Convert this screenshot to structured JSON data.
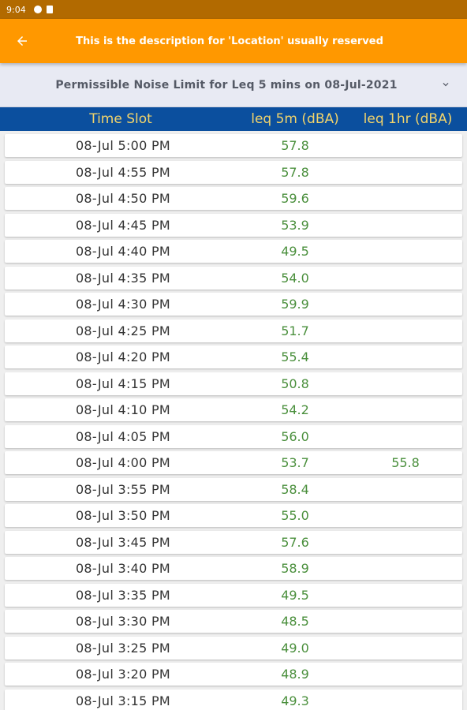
{
  "status_bar": {
    "time": "9:04"
  },
  "app_bar": {
    "title": "This is the description for 'Location' usually reserved"
  },
  "dropdown": {
    "selected": "Permissible Noise Limit for Leq 5 mins on 08-Jul-2021"
  },
  "table": {
    "headers": {
      "time_slot": "Time Slot",
      "leq_5m": "leq 5m (dBA)",
      "leq_1hr": "leq 1hr (dBA)"
    },
    "rows": [
      {
        "time": "08-Jul 5:00 PM",
        "leq5m": "57.8",
        "leq1hr": ""
      },
      {
        "time": "08-Jul 4:55 PM",
        "leq5m": "57.8",
        "leq1hr": ""
      },
      {
        "time": "08-Jul 4:50 PM",
        "leq5m": "59.6",
        "leq1hr": ""
      },
      {
        "time": "08-Jul 4:45 PM",
        "leq5m": "53.9",
        "leq1hr": ""
      },
      {
        "time": "08-Jul 4:40 PM",
        "leq5m": "49.5",
        "leq1hr": ""
      },
      {
        "time": "08-Jul 4:35 PM",
        "leq5m": "54.0",
        "leq1hr": ""
      },
      {
        "time": "08-Jul 4:30 PM",
        "leq5m": "59.9",
        "leq1hr": ""
      },
      {
        "time": "08-Jul 4:25 PM",
        "leq5m": "51.7",
        "leq1hr": ""
      },
      {
        "time": "08-Jul 4:20 PM",
        "leq5m": "55.4",
        "leq1hr": ""
      },
      {
        "time": "08-Jul 4:15 PM",
        "leq5m": "50.8",
        "leq1hr": ""
      },
      {
        "time": "08-Jul 4:10 PM",
        "leq5m": "54.2",
        "leq1hr": ""
      },
      {
        "time": "08-Jul 4:05 PM",
        "leq5m": "56.0",
        "leq1hr": ""
      },
      {
        "time": "08-Jul 4:00 PM",
        "leq5m": "53.7",
        "leq1hr": "55.8"
      },
      {
        "time": "08-Jul 3:55 PM",
        "leq5m": "58.4",
        "leq1hr": ""
      },
      {
        "time": "08-Jul 3:50 PM",
        "leq5m": "55.0",
        "leq1hr": ""
      },
      {
        "time": "08-Jul 3:45 PM",
        "leq5m": "57.6",
        "leq1hr": ""
      },
      {
        "time": "08-Jul 3:40 PM",
        "leq5m": "58.9",
        "leq1hr": ""
      },
      {
        "time": "08-Jul 3:35 PM",
        "leq5m": "49.5",
        "leq1hr": ""
      },
      {
        "time": "08-Jul 3:30 PM",
        "leq5m": "48.5",
        "leq1hr": ""
      },
      {
        "time": "08-Jul 3:25 PM",
        "leq5m": "49.0",
        "leq1hr": ""
      },
      {
        "time": "08-Jul 3:20 PM",
        "leq5m": "48.9",
        "leq1hr": ""
      },
      {
        "time": "08-Jul 3:15 PM",
        "leq5m": "49.3",
        "leq1hr": ""
      }
    ]
  }
}
